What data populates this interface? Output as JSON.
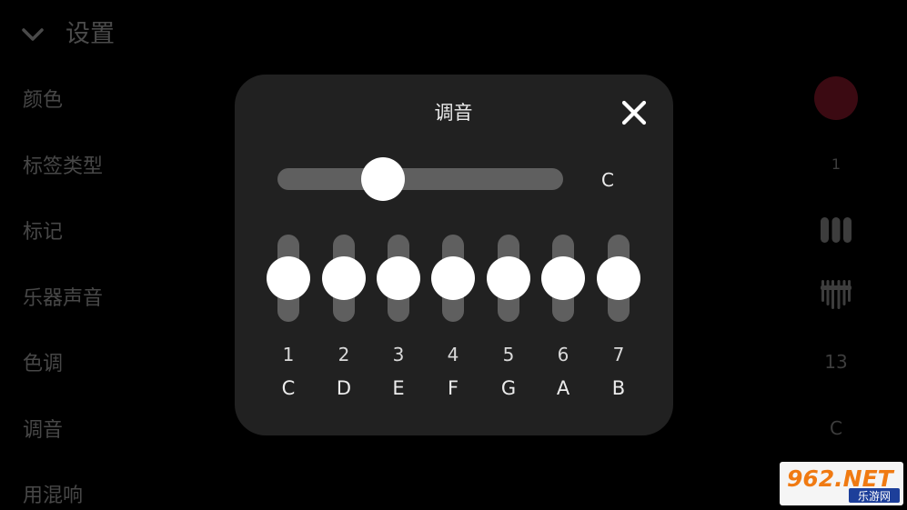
{
  "settings": {
    "title": "设置",
    "rows": [
      {
        "label": "颜色",
        "value": ""
      },
      {
        "label": "标签类型",
        "value": "1"
      },
      {
        "label": "标记",
        "value": ""
      },
      {
        "label": "乐器声音",
        "value": ""
      },
      {
        "label": "色调",
        "value": "13"
      },
      {
        "label": "调音",
        "value": "C"
      },
      {
        "label": "用混响",
        "value": ""
      }
    ],
    "color_value": "#3b0a12",
    "mark_icon": "three-bars-icon",
    "instrument_icon": "kalimba-icon"
  },
  "dialog": {
    "title": "调音",
    "close_icon": "close-icon",
    "key_slider": {
      "value": "C",
      "position": 0.37
    },
    "notes": [
      {
        "number": "1",
        "letter": "C",
        "level": 0.5
      },
      {
        "number": "2",
        "letter": "D",
        "level": 0.5
      },
      {
        "number": "3",
        "letter": "E",
        "level": 0.5
      },
      {
        "number": "4",
        "letter": "F",
        "level": 0.5
      },
      {
        "number": "5",
        "letter": "G",
        "level": 0.5
      },
      {
        "number": "6",
        "letter": "A",
        "level": 0.5
      },
      {
        "number": "7",
        "letter": "B",
        "level": 0.5
      }
    ]
  },
  "watermark": {
    "brand": "962.NET",
    "sub": "乐游网"
  }
}
